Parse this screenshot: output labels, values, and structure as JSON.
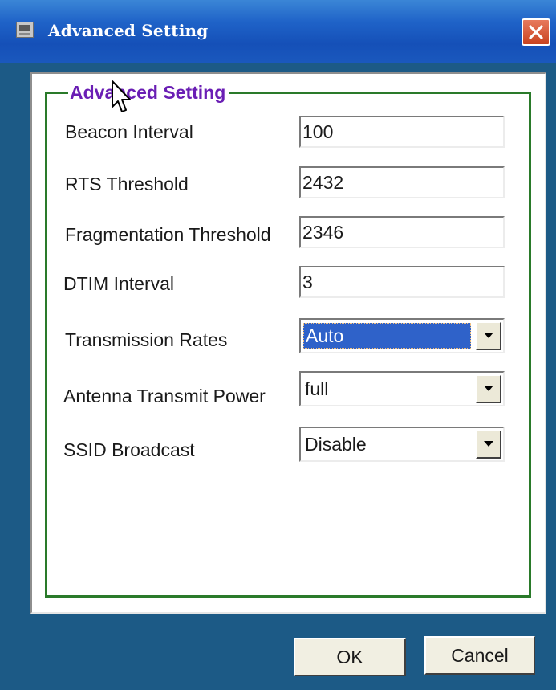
{
  "window": {
    "title": "Advanced Setting"
  },
  "group": {
    "title": "Advanced Setting"
  },
  "fields": {
    "beacon_interval": {
      "label": "Beacon Interval",
      "value": "100"
    },
    "rts_threshold": {
      "label": "RTS Threshold",
      "value": "2432"
    },
    "fragmentation_threshold": {
      "label": "Fragmentation Threshold",
      "value": "2346"
    },
    "dtim_interval": {
      "label": "DTIM Interval",
      "value": "3"
    },
    "transmission_rates": {
      "label": "Transmission Rates",
      "value": "Auto"
    },
    "antenna_transmit_power": {
      "label": "Antenna Transmit Power",
      "value": "full"
    },
    "ssid_broadcast": {
      "label": "SSID Broadcast",
      "value": "Disable"
    }
  },
  "buttons": {
    "ok": "OK",
    "cancel": "Cancel"
  },
  "icons": {
    "app": "app-window-icon",
    "close": "close-icon",
    "dropdown": "chevron-down-icon",
    "cursor": "mouse-pointer-icon"
  },
  "colors": {
    "titlebar": "#1f63c8",
    "window_body": "#1c5a86",
    "group_border": "#2a7a2a",
    "group_title": "#6a1eb4",
    "selection": "#2f62c9",
    "close_button": "#d9553a"
  }
}
